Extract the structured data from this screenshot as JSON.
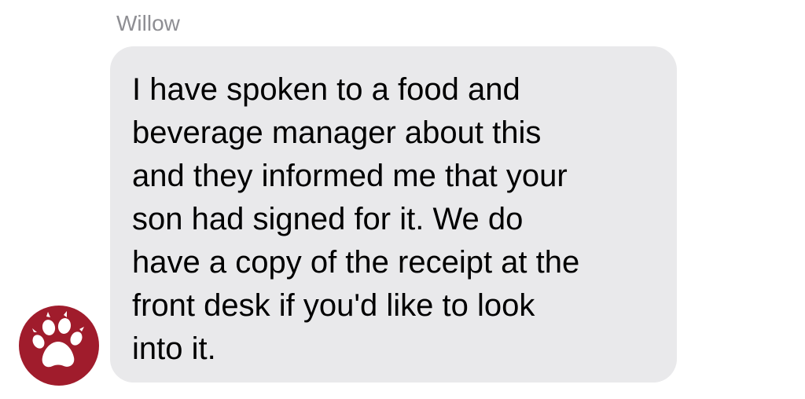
{
  "message": {
    "sender_name": "Willow",
    "lines": [
      "I have spoken to a food and",
      "beverage manager about this",
      "and they informed me that your",
      "son had signed for it. We do",
      "have a copy of the receipt at the",
      "front desk if you'd like to look",
      "into it."
    ]
  },
  "avatar": {
    "icon": "paw-print-icon",
    "background_color": "#a01c2c",
    "icon_color": "#ffffff"
  },
  "colors": {
    "bubble": "#e9e9eb",
    "sender_name": "#8e8e93",
    "text": "#000000"
  }
}
